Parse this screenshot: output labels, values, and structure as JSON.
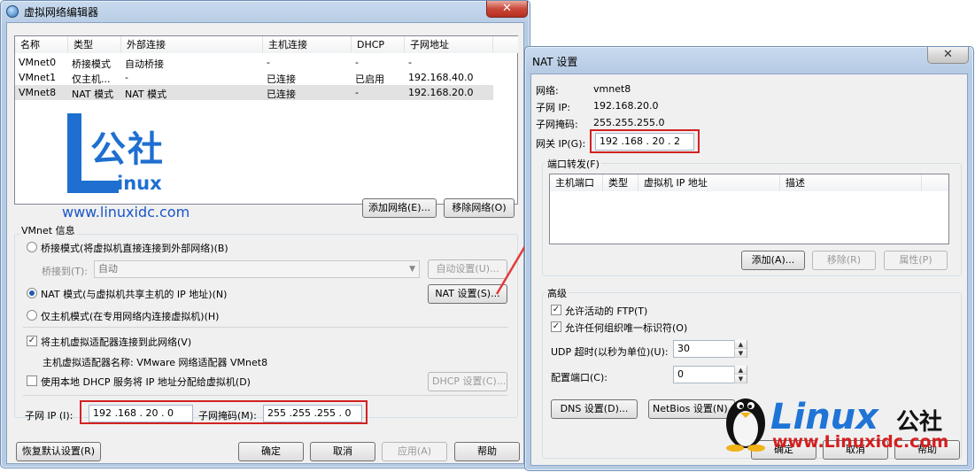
{
  "editor": {
    "title": "虚拟网络编辑器",
    "close_glyph": "✕",
    "table": {
      "headers": [
        "名称",
        "类型",
        "外部连接",
        "主机连接",
        "DHCP",
        "子网地址"
      ],
      "rows": [
        [
          "VMnet0",
          "桥接模式",
          "自动桥接",
          "-",
          "-",
          "-"
        ],
        [
          "VMnet1",
          "仅主机...",
          "-",
          "已连接",
          "已启用",
          "192.168.40.0"
        ],
        [
          "VMnet8",
          "NAT 模式",
          "NAT 模式",
          "已连接",
          "-",
          "192.168.20.0"
        ]
      ],
      "selected_row": 2
    },
    "add_network": "添加网络(E)...",
    "remove_network": "移除网络(O)",
    "vmnet_info": "VMnet 信息",
    "bridge_mode": "桥接模式(将虚拟机直接连接到外部网络)(B)",
    "bridge_to_label": "桥接到(T):",
    "bridge_to_value": "自动",
    "auto_settings": "自动设置(U)...",
    "nat_mode": "NAT 模式(与虚拟机共享主机的 IP 地址)(N)",
    "nat_settings": "NAT 设置(S)...",
    "host_only": "仅主机模式(在专用网络内连接虚拟机)(H)",
    "connect_adapter": "将主机虚拟适配器连接到此网络(V)",
    "adapter_name": "主机虚拟适配器名称: VMware 网络适配器 VMnet8",
    "use_dhcp": "使用本地 DHCP 服务将 IP 地址分配给虚拟机(D)",
    "dhcp_settings": "DHCP 设置(C)...",
    "subnet_ip_label": "子网 IP (I):",
    "subnet_ip": "192 .168 . 20 . 0",
    "subnet_mask_label": "子网掩码(M):",
    "subnet_mask": "255 .255 .255 . 0",
    "restore_defaults": "恢复默认设置(R)",
    "ok": "确定",
    "cancel": "取消",
    "apply": "应用(A)",
    "help": "帮助"
  },
  "nat": {
    "title": "NAT 设置",
    "network_label": "网络:",
    "network_value": "vmnet8",
    "subnet_ip_label": "子网 IP:",
    "subnet_ip_value": "192.168.20.0",
    "subnet_mask_label": "子网掩码:",
    "subnet_mask_value": "255.255.255.0",
    "gateway_label": "网关 IP(G):",
    "gateway_value": "192 .168 . 20 . 2",
    "port_forwarding": "端口转发(F)",
    "pf_headers": [
      "主机端口",
      "类型",
      "虚拟机 IP 地址",
      "描述"
    ],
    "add": "添加(A)...",
    "remove": "移除(R)",
    "properties": "属性(P)",
    "advanced": "高级",
    "allow_ftp": "允许活动的 FTP(T)",
    "allow_any_oui": "允许任何组织唯一标识符(O)",
    "udp_timeout_label": "UDP 超时(以秒为单位)(U):",
    "udp_timeout": "30",
    "config_port_label": "配置端口(C):",
    "config_port": "0",
    "dns_settings": "DNS 设置(D)...",
    "netbios_settings": "NetBios 设置(N)...",
    "ok": "确定",
    "cancel": "取消",
    "help": "帮助"
  },
  "watermarks": {
    "logo_word": "公社",
    "logo_sub": "inux",
    "site_left": "www.linuxidc.com",
    "brand": "Linux",
    "brand_cn": "公社",
    "site_right": "www.Linuxidc.com"
  },
  "colors": {
    "highlight": "#d32222",
    "brand_blue": "#1e6fd0"
  }
}
